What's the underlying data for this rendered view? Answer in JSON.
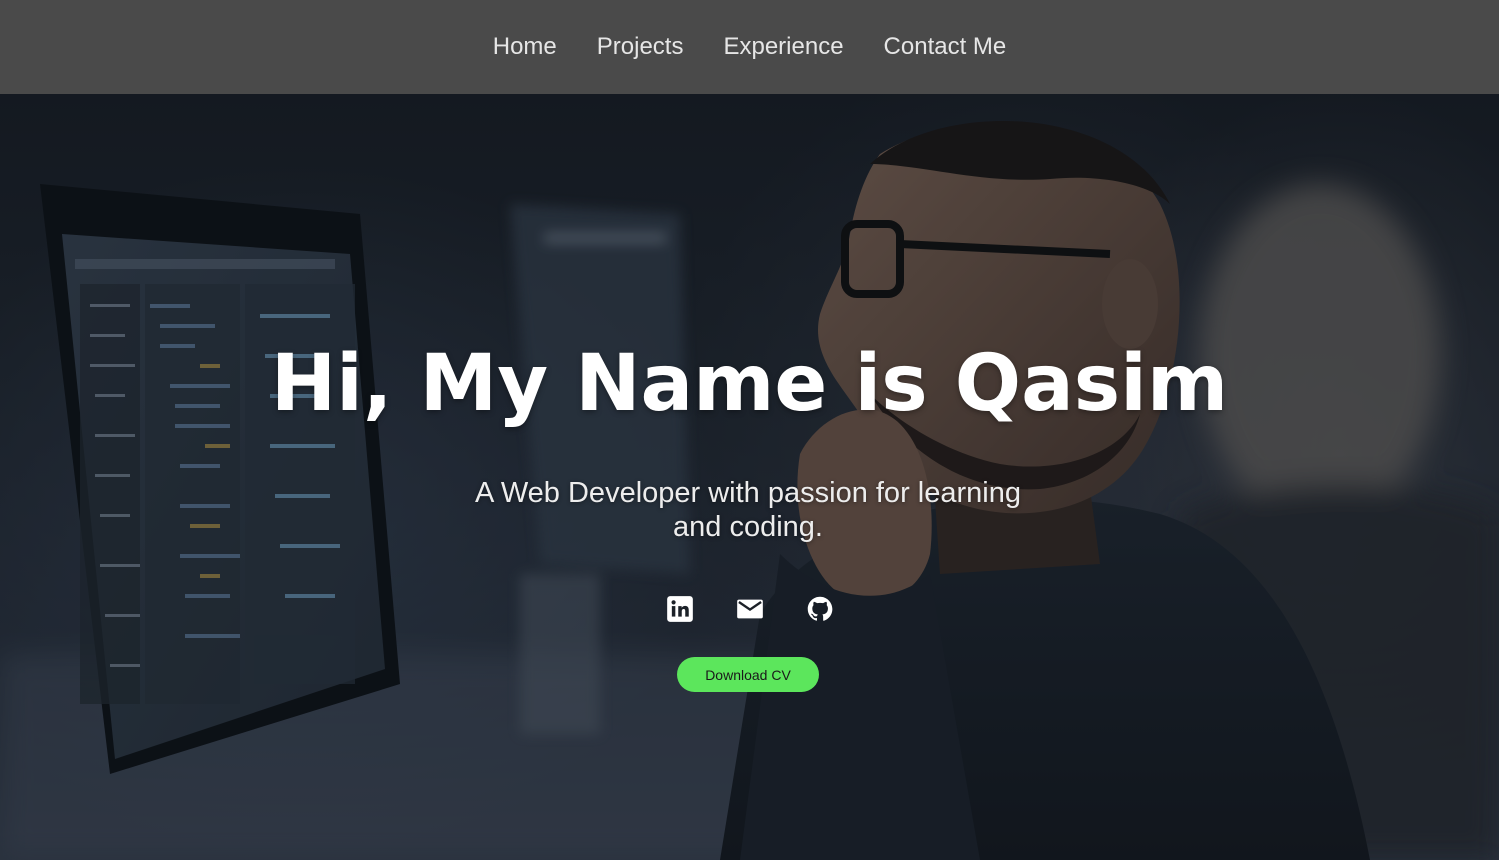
{
  "nav": {
    "items": [
      {
        "label": "Home"
      },
      {
        "label": "Projects"
      },
      {
        "label": "Experience"
      },
      {
        "label": "Contact Me"
      }
    ]
  },
  "hero": {
    "title": "Hi, My Name is Qasim",
    "subtitle": "A Web Developer with passion for learning and coding.",
    "socials": [
      {
        "icon": "linkedin-icon"
      },
      {
        "icon": "mail-icon"
      },
      {
        "icon": "github-icon"
      }
    ],
    "cv_button_label": "Download CV"
  },
  "colors": {
    "navbar_bg": "#4a4a4a",
    "nav_text": "#e6e6e6",
    "cv_button_bg": "#5ce65c",
    "title_text": "#ffffff"
  }
}
